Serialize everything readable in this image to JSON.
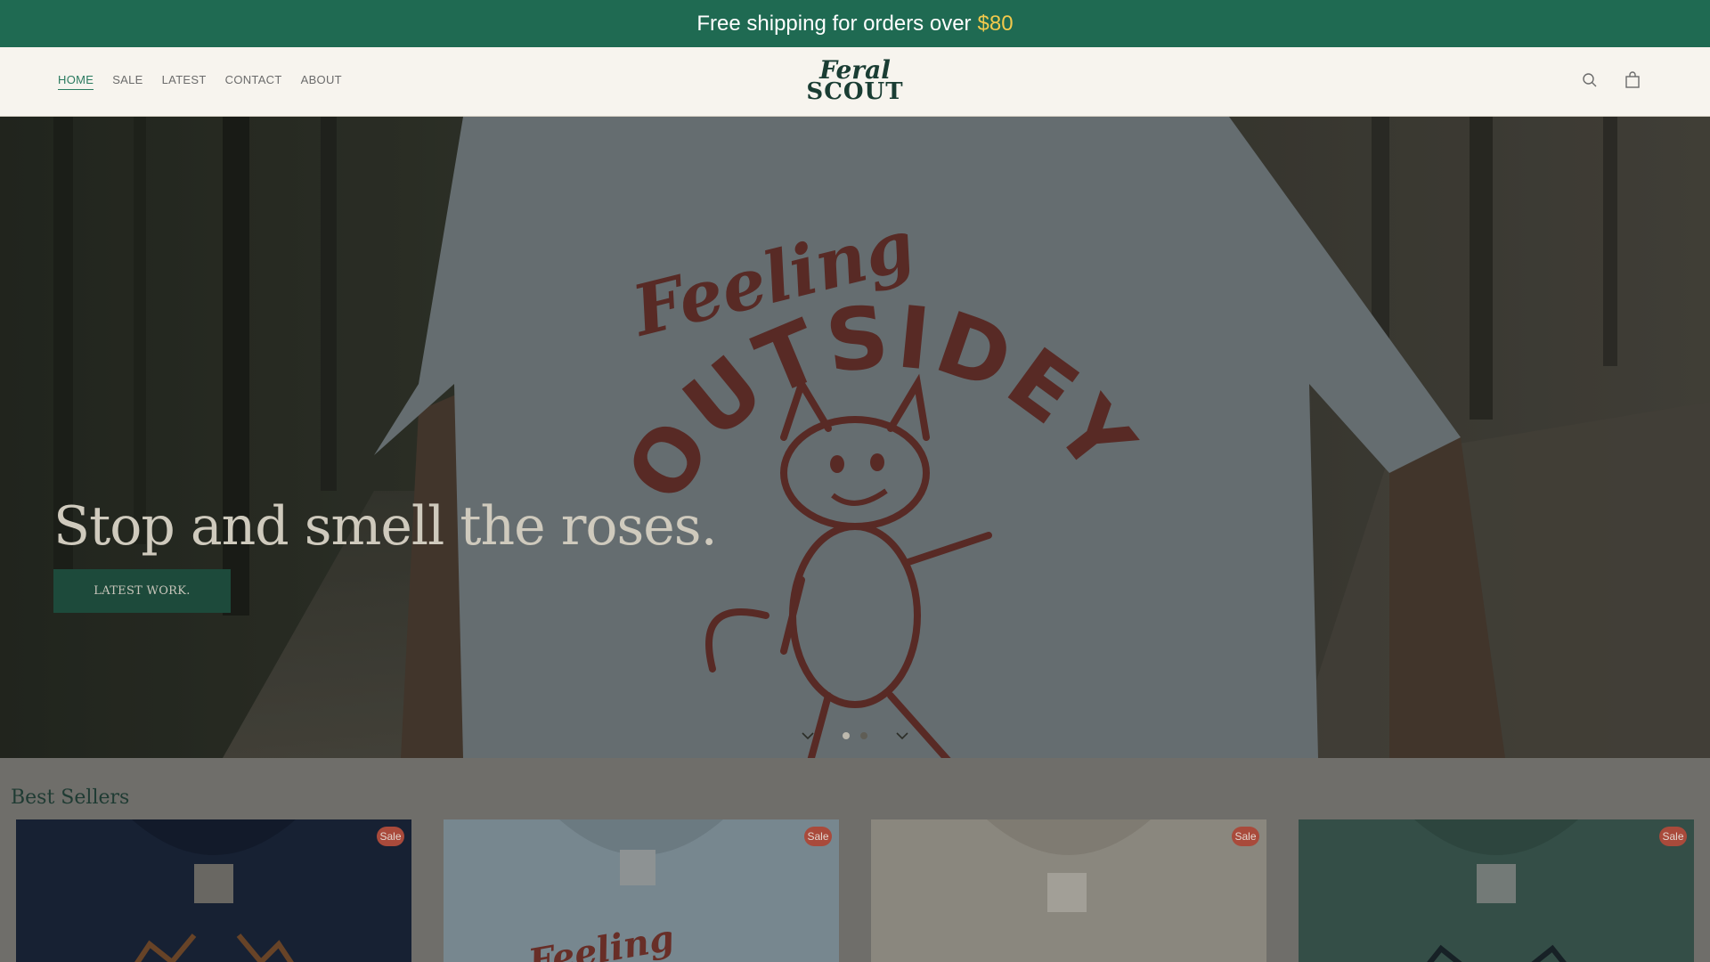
{
  "announcement": {
    "text": "Free shipping for orders over",
    "amount": "$80"
  },
  "nav": {
    "items": [
      {
        "label": "HOME",
        "active": true
      },
      {
        "label": "SALE",
        "active": false
      },
      {
        "label": "LATEST",
        "active": false
      },
      {
        "label": "CONTACT",
        "active": false
      },
      {
        "label": "ABOUT",
        "active": false
      }
    ]
  },
  "logo": {
    "line1": "Feral",
    "line2": "SCOUT"
  },
  "header_icons": [
    "search-icon",
    "cart-icon"
  ],
  "hero": {
    "title": "Stop and smell the roses.",
    "button": "LATEST WORK.",
    "shirt_text_top": "Feeling",
    "shirt_text_arc": "OUTSIDEY",
    "slides": 2,
    "active_slide": 1
  },
  "best_sellers": {
    "title": "Best Sellers",
    "cards": [
      {
        "badge": "Sale",
        "shirt_color": "#1f2c45"
      },
      {
        "badge": "Sale",
        "shirt_color": "#9fb4bf"
      },
      {
        "badge": "Sale",
        "shirt_color": "#b9b4a8"
      },
      {
        "badge": "Sale",
        "shirt_color": "#46695f"
      }
    ]
  },
  "colors": {
    "accent": "#1f6a52",
    "price_highlight": "#f2c94c",
    "sale_badge": "#a94a3b"
  }
}
